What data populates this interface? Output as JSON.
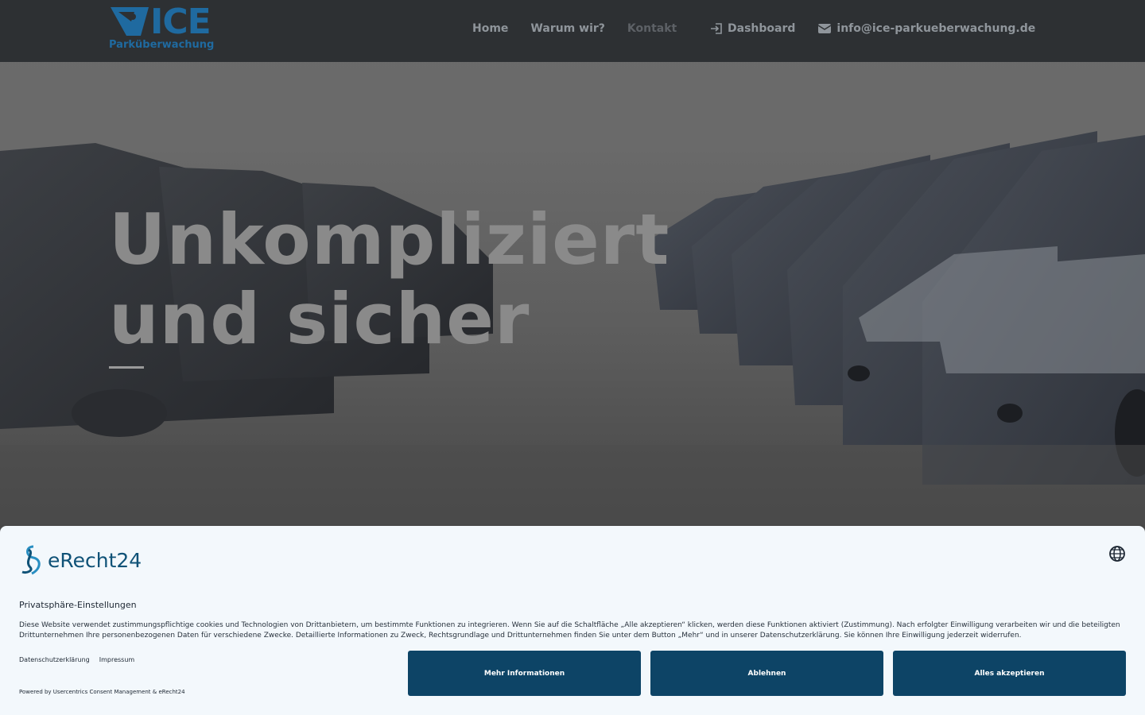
{
  "header": {
    "logo": {
      "title": "ICE",
      "subtitle": "Parküberwachung"
    },
    "nav": [
      {
        "label": "Home"
      },
      {
        "label": "Warum wir?"
      },
      {
        "label": "Kontakt"
      }
    ],
    "dashboard_label": "Dashboard",
    "email_label": "info@ice-parkueberwachung.de",
    "icons": {
      "dashboard": "login-icon",
      "email": "envelope-icon"
    }
  },
  "hero": {
    "line1": "Unkompliziert",
    "line2": "und sicher"
  },
  "consent": {
    "brand": "eRecht24",
    "title": "Privatsphäre-Einstellungen",
    "description": "Diese Website verwendet zustimmungspflichtige cookies und Technologien von Drittanbietern, um bestimmte Funktionen zu integrieren. Wenn Sie auf die Schaltfläche „Alle akzeptieren“ klicken, werden diese Funktionen aktiviert (Zustimmung). Nach erfolgter Einwilligung verarbeiten wir und die beteiligten Drittunternehmen Ihre personenbezogenen Daten für verschiedene Zwecke. Detaillierte Informationen zu Zweck, Rechtsgrundlage und Drittunternehmen finden Sie unter dem Button „Mehr“ und in unserer Datenschutzerklärung. Sie können Ihre Einwilligung jederzeit widerrufen.",
    "link_privacy": "Datenschutzerklärung",
    "link_imprint": "Impressum",
    "powered": "Powered by Usercentrics Consent Management & eRecht24",
    "btn_more": "Mehr Informationen",
    "btn_deny": "Ablehnen",
    "btn_accept": "Alles akzeptieren",
    "colors": {
      "button": "#0d4466",
      "background": "#f3f8fc",
      "brand": "#0f5277"
    }
  }
}
